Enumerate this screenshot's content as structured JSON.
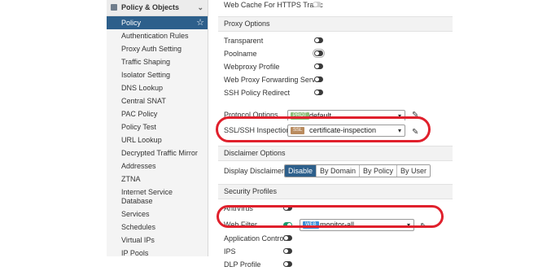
{
  "sidebar": {
    "section_title": "Policy & Objects",
    "items": [
      {
        "label": "Policy"
      },
      {
        "label": "Authentication Rules"
      },
      {
        "label": "Proxy Auth Setting"
      },
      {
        "label": "Traffic Shaping"
      },
      {
        "label": "Isolator Setting"
      },
      {
        "label": "DNS Lookup"
      },
      {
        "label": "Central SNAT"
      },
      {
        "label": "PAC Policy"
      },
      {
        "label": "Policy Test"
      },
      {
        "label": "URL Lookup"
      },
      {
        "label": "Decrypted Traffic Mirror"
      },
      {
        "label": "Addresses"
      },
      {
        "label": "ZTNA"
      },
      {
        "label": "Internet Service Database"
      },
      {
        "label": "Services"
      },
      {
        "label": "Schedules"
      },
      {
        "label": "Virtual IPs"
      },
      {
        "label": "IP Pools"
      }
    ]
  },
  "main": {
    "top_row": "Web Cache For HTTPS Traffic",
    "proxy_options": {
      "title": "Proxy Options",
      "items": [
        "Transparent",
        "Poolname",
        "Webproxy Profile",
        "Web Proxy Forwarding Server",
        "SSH Policy Redirect"
      ]
    },
    "protocol_options": {
      "label": "Protocol Options",
      "badge": "PROT",
      "value": "default"
    },
    "ssl_inspection": {
      "label": "SSL/SSH Inspection",
      "badge": "SSL",
      "value": "certificate-inspection"
    },
    "disclaimer": {
      "title": "Disclaimer Options",
      "label": "Display Disclaimer",
      "options": [
        "Disable",
        "By Domain",
        "By Policy",
        "By User"
      ],
      "selected": "Disable"
    },
    "security_profiles": {
      "title": "Security Profiles",
      "antivirus": "AntiVirus",
      "web_filter": {
        "label": "Web Filter",
        "badge": "WEB",
        "value": "monitor-all"
      },
      "application_control": "Application Control",
      "ips": "IPS",
      "dlp": "DLP Profile"
    }
  },
  "colors": {
    "accent": "#2d5f8b",
    "toggle_on": "#1a9a6a",
    "highlight": "#e0202c"
  }
}
